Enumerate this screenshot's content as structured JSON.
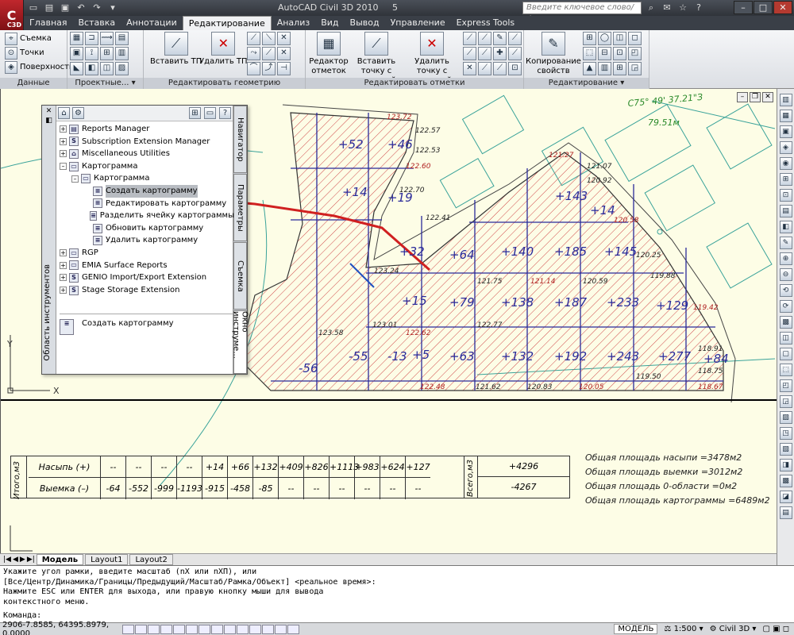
{
  "app": {
    "title": "AutoCAD Civil 3D 2010",
    "file": "5",
    "logo": "C3D"
  },
  "search": {
    "placeholder": "Введите ключевое слово/фразу"
  },
  "tabs": [
    "Главная",
    "Вставка",
    "Аннотации",
    "Редактирование",
    "Анализ",
    "Вид",
    "Вывод",
    "Управление",
    "Express Tools"
  ],
  "active_tab": "Редактирование",
  "ribbon": {
    "panel1": {
      "items": [
        "Съемка",
        "Точки",
        "Поверхность"
      ],
      "title": "Данные рельефа"
    },
    "panel2": {
      "title": "Проектные..."
    },
    "panel3": {
      "btn1": "Вставить ТП",
      "btn2": "Удалить ТП",
      "title": "Редактировать геометрию"
    },
    "panel4": {
      "btn1": "Редактор отметок",
      "btn2": "Вставить точку с отметкой",
      "btn3": "Удалить точку с отметкой",
      "title": "Редактировать отметки"
    },
    "panel5": {
      "btn1": "Копирование свойств",
      "title": "Редактирование"
    }
  },
  "toolspace": {
    "strip_label": "Область инструментов",
    "vtabs": [
      "Навигатор",
      "Параметры",
      "Съемка",
      "Окно инструме..."
    ],
    "tree": [
      {
        "label": "Reports Manager",
        "level": 0,
        "icon": "report-icon"
      },
      {
        "label": "Subscription Extension Manager",
        "level": 0,
        "icon": "s-icon"
      },
      {
        "label": "Miscellaneous Utilities",
        "level": 0,
        "icon": "toolbox-icon"
      },
      {
        "label": "Картограмма",
        "level": 0,
        "icon": "folder-icon"
      },
      {
        "label": "Картограмма",
        "level": 1,
        "icon": "folder-icon"
      },
      {
        "label": "Создать картограмму",
        "level": 2,
        "icon": "doc-icon",
        "selected": true
      },
      {
        "label": "Редактировать картограмму",
        "level": 2,
        "icon": "doc-icon"
      },
      {
        "label": "Разделить ячейку картограммы",
        "level": 2,
        "icon": "doc-icon"
      },
      {
        "label": "Обновить картограмму",
        "level": 2,
        "icon": "doc-icon"
      },
      {
        "label": "Удалить картограмму",
        "level": 2,
        "icon": "doc-icon"
      },
      {
        "label": "RGP",
        "level": 0,
        "icon": "folder-icon"
      },
      {
        "label": "EMIA Surface Reports",
        "level": 0,
        "icon": "folder-icon"
      },
      {
        "label": "GENIO Import/Export Extension",
        "level": 0,
        "icon": "s-icon"
      },
      {
        "label": "Stage Storage Extension",
        "level": 0,
        "icon": "s-icon"
      }
    ],
    "description": "Создать картограмму"
  },
  "drawing": {
    "cell_values": [
      "+52",
      "+46",
      "+14",
      "+19",
      "+32",
      "+64",
      "+140",
      "+185",
      "+145",
      "+143",
      "+14",
      "+15",
      "+79",
      "+138",
      "+187",
      "+233",
      "+129",
      "-55",
      "-13",
      "+5",
      "+63",
      "+132",
      "+192",
      "+243",
      "+277",
      "+84",
      "-56"
    ],
    "elev_labels": [
      "123.72",
      "122.57",
      "122.53",
      "122.60",
      "122.70",
      "122.41",
      "121.27",
      "121.07",
      "120.92",
      "120.58",
      "120.25",
      "119.88",
      "119.42",
      "118.91",
      "118.75",
      "118.67",
      "123.24",
      "123.01",
      "122.62",
      "122.77",
      "121.75",
      "121.14",
      "120.59",
      "123.58",
      "122.48",
      "121.62",
      "120.83",
      "120.05",
      "119.50"
    ],
    "bearing": "C75° 49' 37.21\"З",
    "distance": "79.51м"
  },
  "earthwork_table": {
    "side_label_left": "Итого,м3",
    "side_label_right": "Всего,м3",
    "fill_label": "Насыпь (+)",
    "fill_values": [
      "--",
      "--",
      "--",
      "--",
      "+14",
      "+66",
      "+132",
      "+409",
      "+826",
      "+1113",
      "+983",
      "+624",
      "+127"
    ],
    "cut_label": "Выемка (–)",
    "cut_values": [
      "-64",
      "-552",
      "-999",
      "-1193",
      "-915",
      "-458",
      "-85",
      "--",
      "--",
      "--",
      "--",
      "--",
      "--"
    ],
    "total_fill": "+4296",
    "total_cut": "-4267"
  },
  "summary": [
    "Общая площадь насыпи =3478м2",
    "Общая площадь выемки =3012м2",
    "Общая площадь 0-области =0м2",
    "Общая площадь картограммы =6489м2"
  ],
  "layout_tabs": [
    "Модель",
    "Layout1",
    "Layout2"
  ],
  "command_lines": [
    "Укажите угол рамки, введите масштаб (nX или nXП), или",
    "[Все/Центр/Динамика/Границы/Предыдущий/Масштаб/Рамка/Объект] <реальное время>:",
    "Нажмите ESC или ENTER для выхода, или правую кнопку мыши для вывода",
    "контекстного меню."
  ],
  "command_prompt": "Команда:",
  "status": {
    "coords": "2906-7.8585, 64395.8979, 0.0000",
    "model": "МОДЕЛЬ",
    "scale": "1:500",
    "workspace": "Civil 3D"
  },
  "colors": {
    "drawing_bg": "#fdfde6",
    "grid": "#2a2a9a",
    "fill_hatch": "#c83232",
    "cut": "#d02020",
    "annot": "#3aa39a"
  }
}
